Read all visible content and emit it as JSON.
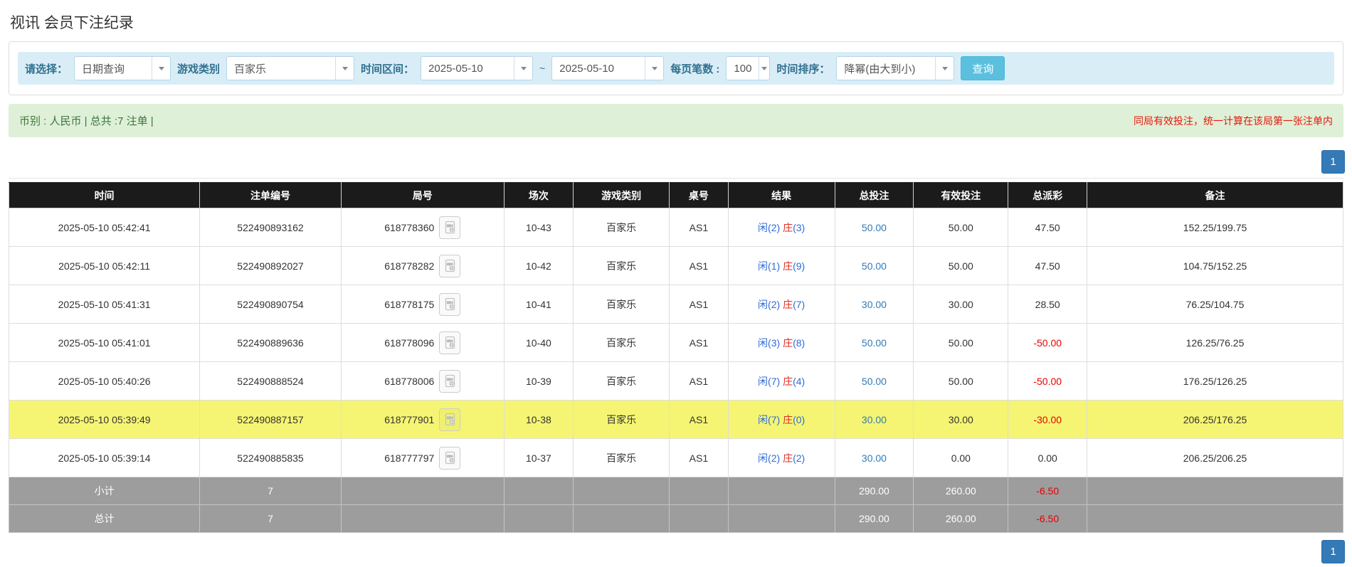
{
  "page": {
    "title": "视讯 会员下注纪录"
  },
  "filters": {
    "select_label": "请选择：",
    "select_value": "日期查询",
    "game_label": "游戏类别",
    "game_value": "百家乐",
    "range_label": "时间区间：",
    "date_from": "2025-05-10",
    "tilde": "~",
    "date_to": "2025-05-10",
    "per_page_label": "每页笔数 :",
    "per_page_value": "100",
    "sort_label": "时间排序：",
    "sort_value": "降幂(由大到小)",
    "query_button": "查询"
  },
  "alert_bar": {
    "left_text": "币别 : 人民币 | 总共 :7 注单 |",
    "right_text": "同局有效投注，统一计算在该局第一张注单内"
  },
  "pagination": {
    "page": "1"
  },
  "colors": {
    "accent_blue": "#337ab7",
    "query_button": "#5bc0de",
    "highlight_row": "#f5f573",
    "negative": "#e60000",
    "player_blue": "#2f6bd8",
    "banker_red": "#e02b20"
  },
  "icons": {
    "video_icon": "video-record-icon",
    "dropdown_icon": "chevron-down-icon"
  },
  "table": {
    "headers": [
      "时间",
      "注单编号",
      "局号",
      "场次",
      "游戏类别",
      "桌号",
      "结果",
      "总投注",
      "有效投注",
      "总派彩",
      "备注"
    ],
    "rows": [
      {
        "time": "2025-05-10 05:42:41",
        "bet_id": "522490893162",
        "round": "618778360",
        "session": "10-43",
        "game": "百家乐",
        "table_no": "AS1",
        "result_player": "闲(2)",
        "result_banker": "庄",
        "result_banker_score": "(3)",
        "total_bet": "50.00",
        "valid_bet": "50.00",
        "payout": "47.50",
        "remark": "152.25/199.75",
        "highlight": false
      },
      {
        "time": "2025-05-10 05:42:11",
        "bet_id": "522490892027",
        "round": "618778282",
        "session": "10-42",
        "game": "百家乐",
        "table_no": "AS1",
        "result_player": "闲(1)",
        "result_banker": "庄",
        "result_banker_score": "(9)",
        "total_bet": "50.00",
        "valid_bet": "50.00",
        "payout": "47.50",
        "remark": "104.75/152.25",
        "highlight": false
      },
      {
        "time": "2025-05-10 05:41:31",
        "bet_id": "522490890754",
        "round": "618778175",
        "session": "10-41",
        "game": "百家乐",
        "table_no": "AS1",
        "result_player": "闲(2)",
        "result_banker": "庄",
        "result_banker_score": "(7)",
        "total_bet": "30.00",
        "valid_bet": "30.00",
        "payout": "28.50",
        "remark": "76.25/104.75",
        "highlight": false
      },
      {
        "time": "2025-05-10 05:41:01",
        "bet_id": "522490889636",
        "round": "618778096",
        "session": "10-40",
        "game": "百家乐",
        "table_no": "AS1",
        "result_player": "闲(3)",
        "result_banker": "庄",
        "result_banker_score": "(8)",
        "total_bet": "50.00",
        "valid_bet": "50.00",
        "payout": "-50.00",
        "remark": "126.25/76.25",
        "highlight": false
      },
      {
        "time": "2025-05-10 05:40:26",
        "bet_id": "522490888524",
        "round": "618778006",
        "session": "10-39",
        "game": "百家乐",
        "table_no": "AS1",
        "result_player": "闲(7)",
        "result_banker": "庄",
        "result_banker_score": "(4)",
        "total_bet": "50.00",
        "valid_bet": "50.00",
        "payout": "-50.00",
        "remark": "176.25/126.25",
        "highlight": false
      },
      {
        "time": "2025-05-10 05:39:49",
        "bet_id": "522490887157",
        "round": "618777901",
        "session": "10-38",
        "game": "百家乐",
        "table_no": "AS1",
        "result_player": "闲(7)",
        "result_banker": "庄",
        "result_banker_score": "(0)",
        "total_bet": "30.00",
        "valid_bet": "30.00",
        "payout": "-30.00",
        "remark": "206.25/176.25",
        "highlight": true
      },
      {
        "time": "2025-05-10 05:39:14",
        "bet_id": "522490885835",
        "round": "618777797",
        "session": "10-37",
        "game": "百家乐",
        "table_no": "AS1",
        "result_player": "闲(2)",
        "result_banker": "庄",
        "result_banker_score": "(2)",
        "total_bet": "30.00",
        "valid_bet": "0.00",
        "payout": "0.00",
        "remark": "206.25/206.25",
        "highlight": false
      }
    ],
    "summary_rows": [
      {
        "label": "小计",
        "count": "7",
        "total_bet": "290.00",
        "valid_bet": "260.00",
        "payout": "-6.50"
      },
      {
        "label": "总计",
        "count": "7",
        "total_bet": "290.00",
        "valid_bet": "260.00",
        "payout": "-6.50"
      }
    ]
  }
}
